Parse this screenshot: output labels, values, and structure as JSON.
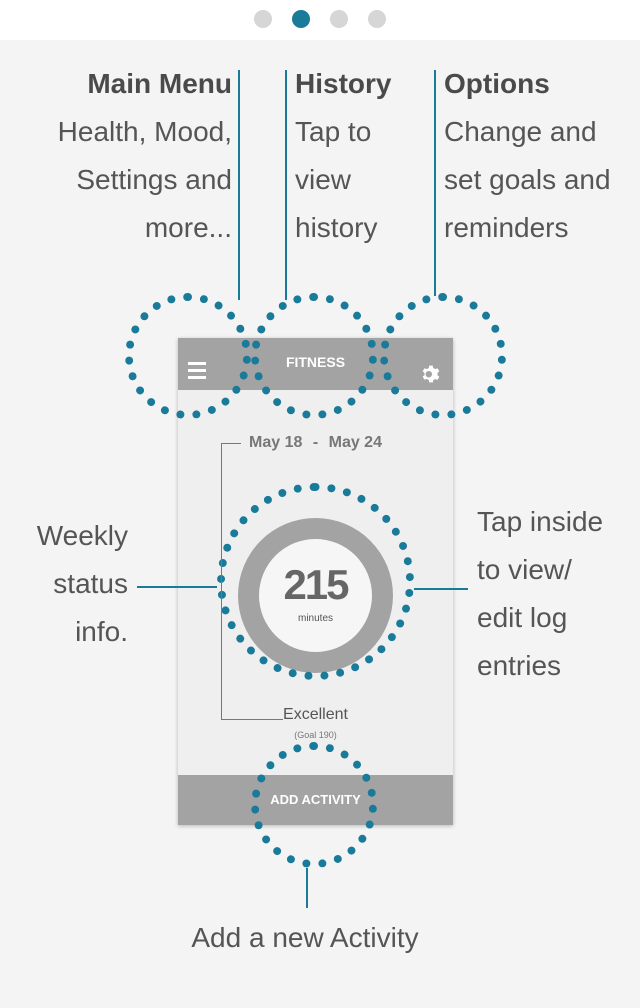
{
  "pagination": {
    "count": 4,
    "active_index": 1
  },
  "annotations": {
    "main_menu": {
      "title": "Main Menu",
      "lines": [
        "Health, Mood,",
        "Settings and",
        "more..."
      ]
    },
    "history": {
      "title": "History",
      "lines": [
        "Tap to",
        "view",
        "history"
      ]
    },
    "options": {
      "title": "Options",
      "lines": [
        "Change and",
        "set goals and",
        "reminders"
      ]
    },
    "weekly": {
      "lines": [
        "Weekly",
        "status",
        "info."
      ]
    },
    "tap_inside": {
      "lines": [
        "Tap inside",
        "to view/",
        "edit log",
        "entries"
      ]
    },
    "add_activity": {
      "text": "Add a new Activity"
    }
  },
  "phone": {
    "title": "FITNESS",
    "date_start": "May 18",
    "date_sep": "-",
    "date_end": "May 24",
    "value": "215",
    "unit": "minutes",
    "status": "Excellent",
    "goal": "(Goal 190)",
    "add_button": "ADD ACTIVITY"
  },
  "colors": {
    "accent": "#1a7a99",
    "header_gray": "#a3a3a3",
    "background": "#f4f4f4"
  },
  "icons": [
    "menu-icon",
    "gear-icon"
  ]
}
